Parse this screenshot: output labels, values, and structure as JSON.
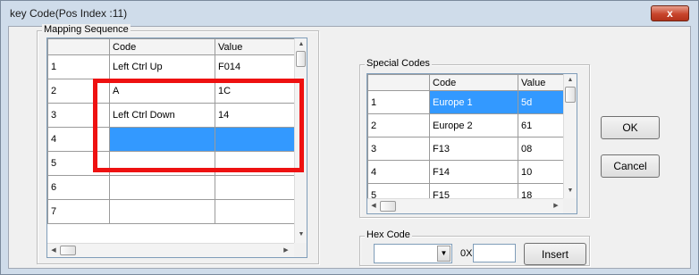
{
  "window": {
    "title": "key Code(Pos Index :11)",
    "close_glyph": "x"
  },
  "mapping": {
    "label": "Mapping Sequence",
    "columns": [
      "Code",
      "Value"
    ],
    "rows": [
      {
        "index": "1",
        "code": "Left Ctrl Up",
        "value": "F014"
      },
      {
        "index": "2",
        "code": "A",
        "value": "1C"
      },
      {
        "index": "3",
        "code": "Left Ctrl Down",
        "value": "14"
      },
      {
        "index": "4",
        "code": "",
        "value": ""
      },
      {
        "index": "5",
        "code": "",
        "value": ""
      },
      {
        "index": "6",
        "code": "",
        "value": ""
      },
      {
        "index": "7",
        "code": "",
        "value": ""
      }
    ],
    "selected_row": "4"
  },
  "special": {
    "label": "Special Codes",
    "columns": [
      "Code",
      "Value"
    ],
    "rows": [
      {
        "index": "1",
        "code": "Europe 1",
        "value": "5d"
      },
      {
        "index": "2",
        "code": "Europe 2",
        "value": "61"
      },
      {
        "index": "3",
        "code": "F13",
        "value": "08"
      },
      {
        "index": "4",
        "code": "F14",
        "value": "10"
      },
      {
        "index": "5",
        "code": "F15",
        "value": "18"
      }
    ],
    "selected_row": "1"
  },
  "hex": {
    "label": "Hex Code",
    "prefix": "0X",
    "combo_value": "",
    "input_value": "",
    "insert_label": "Insert"
  },
  "buttons": {
    "ok": "OK",
    "cancel": "Cancel"
  },
  "icons": {
    "close": "close-icon",
    "up": "arrow-up-icon",
    "down": "arrow-down-icon",
    "left": "arrow-left-icon",
    "right": "arrow-right-icon",
    "dropdown": "chevron-down-icon"
  },
  "colors": {
    "selection": "#3399ff",
    "highlight_box": "#ee1111",
    "titlebar": "#cfdcea",
    "close_button": "#c8452c"
  }
}
